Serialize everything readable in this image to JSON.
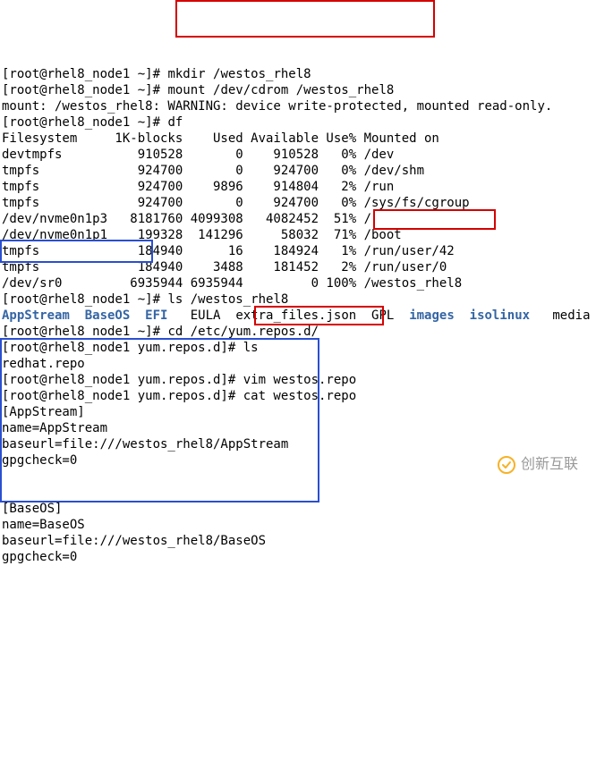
{
  "host": "root@rhel8_node1",
  "prompts": {
    "home": "[root@rhel8_node1 ~]# ",
    "repos": "[root@rhel8_node1 yum.repos.d]# "
  },
  "cmds": {
    "mkdir": "mkdir /westos_rhel8",
    "mount": "mount /dev/cdrom /westos_rhel8",
    "df": "df",
    "lswestos": "ls /westos_rhel8",
    "cd": "cd /etc/yum.repos.d/",
    "ls": "ls",
    "vim": "vim westos.repo",
    "cat": "cat westos.repo"
  },
  "mount_warning": "mount: /westos_rhel8: WARNING: device write-protected, mounted read-only.",
  "df_header": "Filesystem     1K-blocks    Used Available Use% Mounted on",
  "df_rows": [
    "devtmpfs          910528       0    910528   0% /dev",
    "tmpfs             924700       0    924700   0% /dev/shm",
    "tmpfs             924700    9896    914804   2% /run",
    "tmpfs             924700       0    924700   0% /sys/fs/cgroup",
    "/dev/nvme0n1p3   8181760 4099308   4082452  51% /",
    "/dev/nvme0n1p1    199328  141296     58032  71% /boot",
    "tmpfs             184940      16    184924   1% /run/user/42",
    "tmpfs             184940    3488    181452   2% /run/user/0",
    "/dev/sr0         6935944 6935944         0 100% /westos_rhel8"
  ],
  "ls_westos": {
    "dirs": [
      "AppStream",
      "BaseOS",
      "EFI",
      "images",
      "isolinux"
    ],
    "files": [
      "EULA",
      "extra_files.json",
      "GPL",
      "media"
    ]
  },
  "ls_repos": "redhat.repo",
  "repo_file": [
    "[AppStream]",
    "name=AppStream",
    "baseurl=file:///westos_rhel8/AppStream",
    "gpgcheck=0",
    "",
    "",
    "[BaseOS]",
    "name=BaseOS",
    "baseurl=file:///westos_rhel8/BaseOS",
    "gpgcheck=0"
  ],
  "watermark": "创新互联"
}
